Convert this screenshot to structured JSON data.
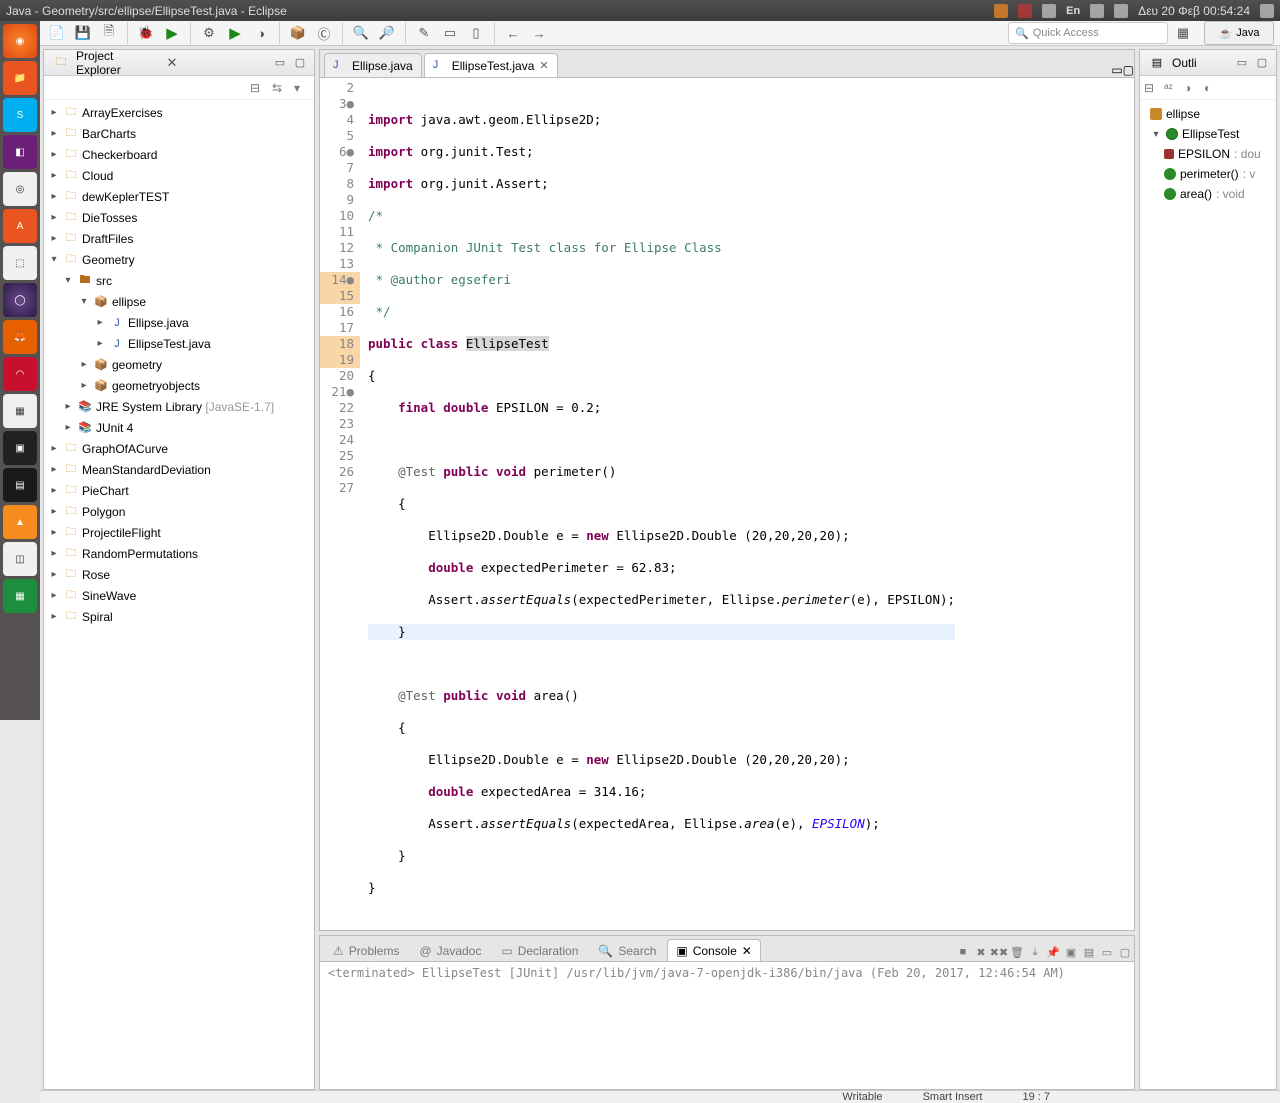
{
  "os": {
    "title": "Java - Geometry/src/ellipse/EllipseTest.java - Eclipse",
    "lang": "En",
    "clock": "Δευ 20 Φεβ 00:54:24"
  },
  "toolbar": {
    "quick_access": "Quick Access",
    "perspective": "Java"
  },
  "explorer": {
    "title": "Project Explorer",
    "projects": [
      "ArrayExercises",
      "BarCharts",
      "Checkerboard",
      "Cloud",
      "dewKeplerTEST",
      "DieTosses",
      "DraftFiles"
    ],
    "open_proj": "Geometry",
    "src": "src",
    "pkg": "ellipse",
    "files": [
      "Ellipse.java",
      "EllipseTest.java"
    ],
    "other_pkgs": [
      "geometry",
      "geometryobjects"
    ],
    "jre": "JRE System Library",
    "jre_note": "[JavaSE-1.7]",
    "junit": "JUnit 4",
    "tail": [
      "GraphOfACurve",
      "MeanStandardDeviation",
      "PieChart",
      "Polygon",
      "ProjectileFlight",
      "RandomPermutations",
      "Rose",
      "SineWave",
      "Spiral"
    ]
  },
  "editor": {
    "tabs": [
      "Ellipse.java",
      "EllipseTest.java"
    ],
    "active": 1,
    "code": {
      "l3a": "import",
      "l3b": " java.awt.geom.Ellipse2D;",
      "l4a": "import",
      "l4b": " org.junit.Test;",
      "l5a": "import",
      "l5b": " org.junit.Assert;",
      "l6": "/*",
      "l7": " * Companion JUnit Test class for Ellipse Class",
      "l8": " * @author egseferi",
      "l9": " */",
      "l10a": "public class ",
      "l10b": "EllipseTest",
      "l11": "{",
      "l12a": "    final double",
      "l12b": " EPSILON = 0.2;",
      "l14a": "    @Test",
      "l14b": "public void",
      "l14c": " perimeter()",
      "l15": "    {",
      "l16a": "        Ellipse2D.Double e = ",
      "l16b": "new",
      "l16c": " Ellipse2D.Double (20,20,20,20);",
      "l17a": "        double",
      "l17b": " expectedPerimeter = 62.83;",
      "l18a": "        Assert.",
      "l18b": "assertEquals",
      "l18c": "(expectedPerimeter, Ellipse.",
      "l18d": "perimeter",
      "l18e": "(e), EPSILON);",
      "l19": "    }",
      "l21a": "    @Test",
      "l21b": "public void",
      "l21c": " area()",
      "l22": "    {",
      "l23a": "        Ellipse2D.Double e = ",
      "l23b": "new",
      "l23c": " Ellipse2D.Double (20,20,20,20);",
      "l24a": "        double",
      "l24b": " expectedArea = 314.16;",
      "l25a": "        Assert.",
      "l25b": "assertEquals",
      "l25c": "(expectedArea, Ellipse.",
      "l25d": "area",
      "l25e": "(e), ",
      "l25f": "EPSILON",
      "l25g": ");",
      "l26": "    }",
      "l27": "}"
    }
  },
  "outline": {
    "title": "Outli",
    "pkg": "ellipse",
    "cls": "EllipseTest",
    "field": "EPSILON",
    "field_t": ": dou",
    "m1": "perimeter()",
    "m1t": ": v",
    "m2": "area()",
    "m2t": ": void"
  },
  "bottom": {
    "tabs": [
      "Problems",
      "Javadoc",
      "Declaration",
      "Search",
      "Console"
    ],
    "active": 4,
    "console": "<terminated> EllipseTest [JUnit] /usr/lib/jvm/java-7-openjdk-i386/bin/java (Feb 20, 2017, 12:46:54 AM)"
  },
  "status": {
    "writable": "Writable",
    "insert": "Smart Insert",
    "pos": "19 : 7"
  }
}
